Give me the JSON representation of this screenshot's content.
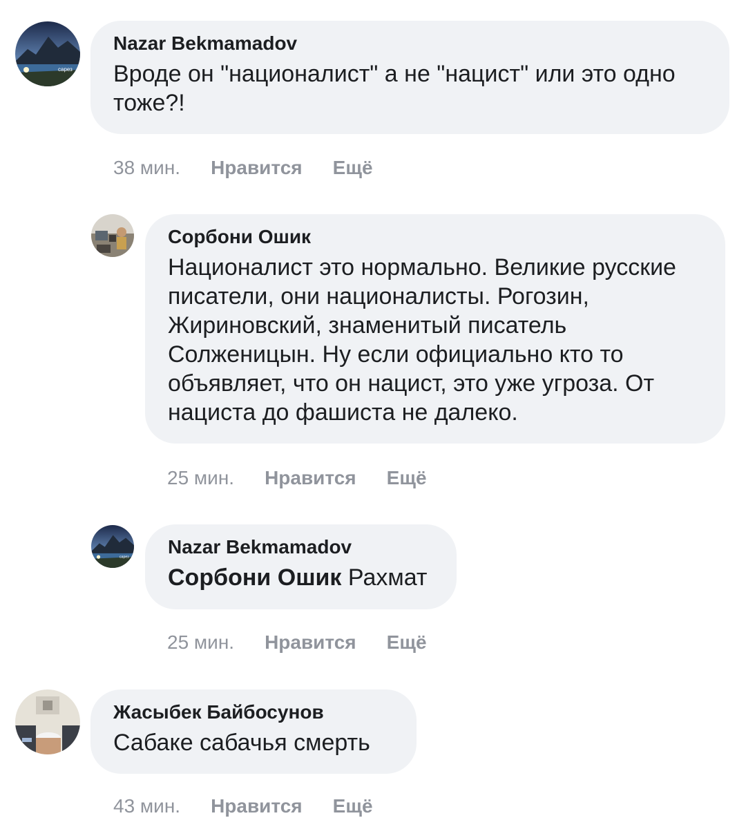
{
  "comments": [
    {
      "author": "Nazar Bekmamadov",
      "text": "Вроде он \"националист\" а не \"нацист\" или это одно тоже?!",
      "time": "38 мин.",
      "like": "Нравится",
      "more": "Ещё"
    },
    {
      "author": "Сорбони Ошик",
      "text": "Националист это нормально. Великие русские писатели, они националисты. Рогозин, Жириновский, знаменитый писатель Солженицын. Ну если официально кто то объявляет, что он нацист, это уже угроза. От нациста до фашиста не далеко.",
      "time": "25 мин.",
      "like": "Нравится",
      "more": "Ещё"
    },
    {
      "author": "Nazar Bekmamadov",
      "mention": "Сорбони Ошик",
      "text": "Рахмат",
      "time": "25 мин.",
      "like": "Нравится",
      "more": "Ещё"
    },
    {
      "author": "Жасыбек Байбосунов",
      "text": "Сабаке сабачья смерть",
      "time": "43 мин.",
      "like": "Нравится",
      "more": "Ещё"
    }
  ],
  "avatar_caption": "сарез",
  "colors": {
    "bubble": "#f0f2f5",
    "meta": "#90949c",
    "text": "#1c1e21"
  }
}
